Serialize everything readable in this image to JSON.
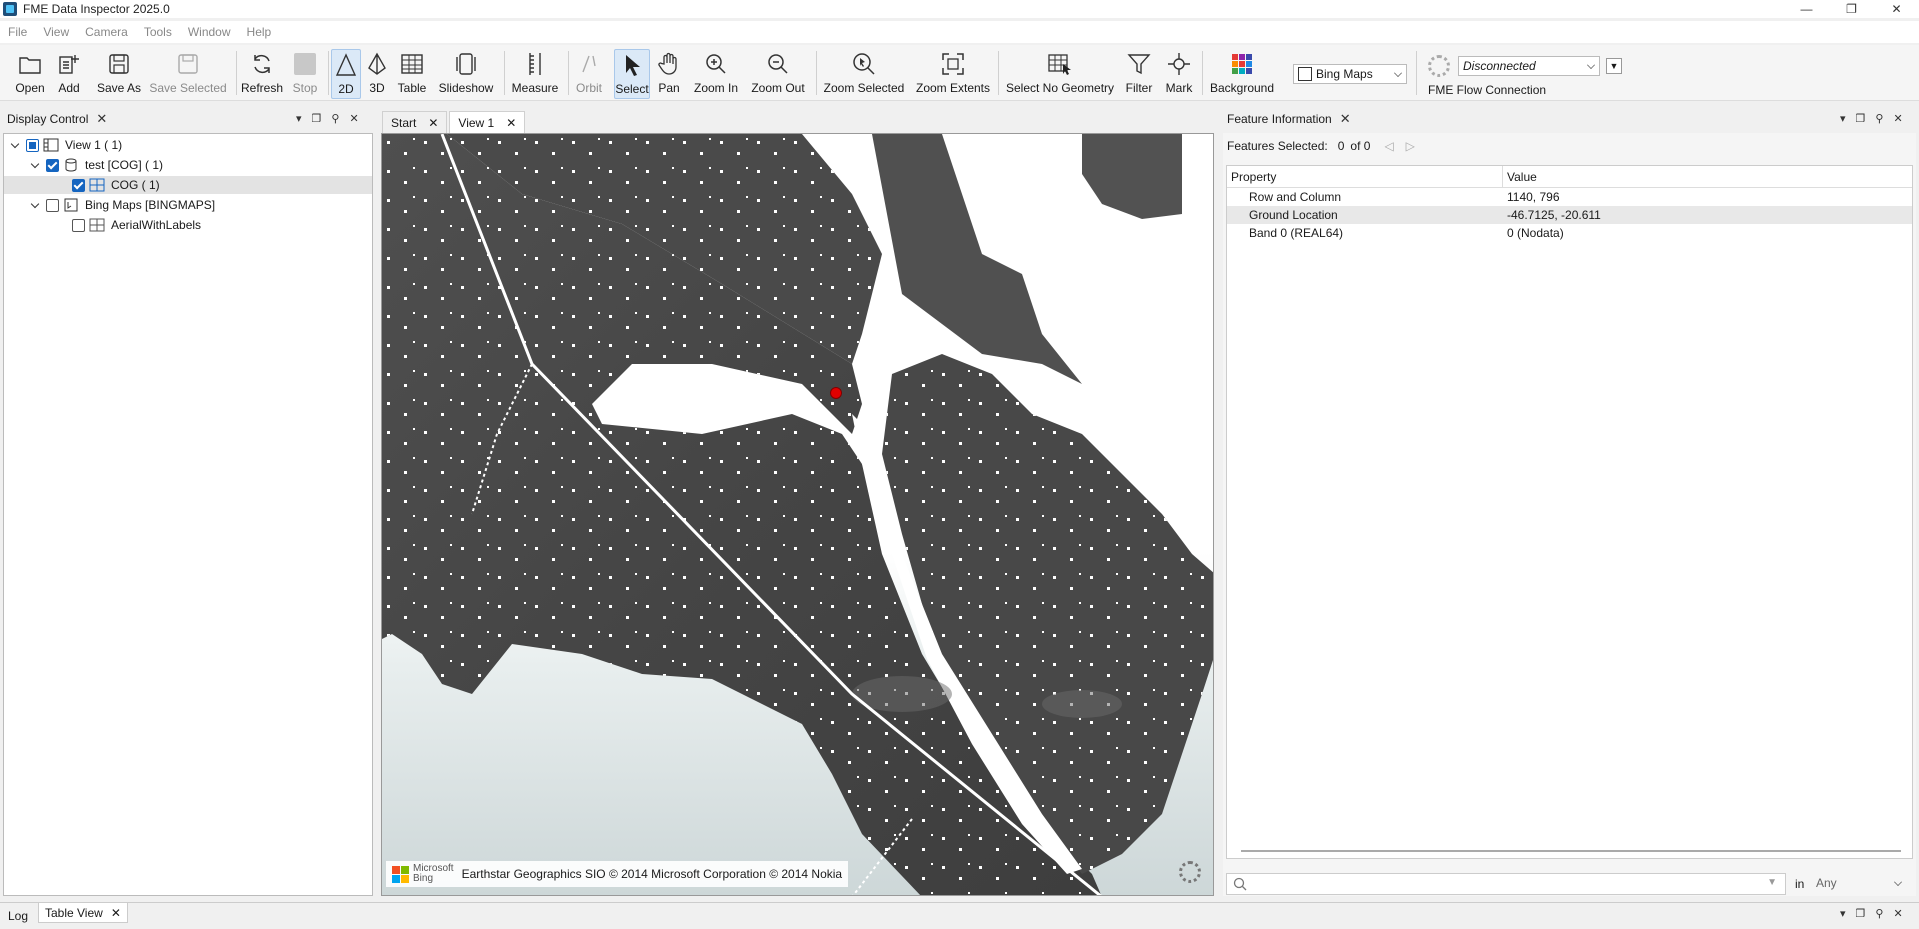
{
  "window": {
    "title": "FME Data Inspector 2025.0"
  },
  "menu": [
    "File",
    "View",
    "Camera",
    "Tools",
    "Window",
    "Help"
  ],
  "toolbar": {
    "open": "Open",
    "add": "Add",
    "save_as": "Save As",
    "save_selected": "Save Selected",
    "refresh": "Refresh",
    "stop": "Stop",
    "two_d": "2D",
    "three_d": "3D",
    "table": "Table",
    "slideshow": "Slideshow",
    "measure": "Measure",
    "orbit": "Orbit",
    "select": "Select",
    "pan": "Pan",
    "zoom_in": "Zoom In",
    "zoom_out": "Zoom Out",
    "zoom_selected": "Zoom Selected",
    "zoom_extents": "Zoom Extents",
    "select_no_geometry": "Select No Geometry",
    "filter": "Filter",
    "mark": "Mark",
    "background": "Background",
    "basemap": "Bing Maps",
    "connection_status": "Disconnected",
    "flow_connection": "FME Flow Connection"
  },
  "display_control": {
    "title": "Display Control",
    "tree": [
      {
        "label": "View 1 ( 1)"
      },
      {
        "label": "test [COG] ( 1)"
      },
      {
        "label": "COG ( 1)"
      },
      {
        "label": "Bing Maps [BINGMAPS]"
      },
      {
        "label": "AerialWithLabels"
      }
    ]
  },
  "tabs": [
    {
      "label": "Start"
    },
    {
      "label": "View 1"
    }
  ],
  "map": {
    "attribution": "Earthstar Geographics SIO © 2014 Microsoft Corporation © 2014 Nokia",
    "logo_line1": "Microsoft",
    "logo_line2": "Bing"
  },
  "feature_info": {
    "title": "Feature Information",
    "selected_label": "Features Selected:",
    "selected_count": "0",
    "of_total": "of 0",
    "columns": {
      "property": "Property",
      "value": "Value"
    },
    "rows": [
      {
        "property": "Row and Column",
        "value": "1140, 796"
      },
      {
        "property": "Ground Location",
        "value": "-46.7125, -20.611"
      },
      {
        "property": "Band 0 (REAL64)",
        "value": "0 (Nodata)"
      }
    ],
    "search_in": "in",
    "search_scope": "Any"
  },
  "bottom_tabs": [
    {
      "label": "Log"
    },
    {
      "label": "Table View"
    }
  ],
  "colors": {
    "accent": "#1565c0",
    "marker": "#e00000",
    "terrain": "#4a4a4a"
  }
}
